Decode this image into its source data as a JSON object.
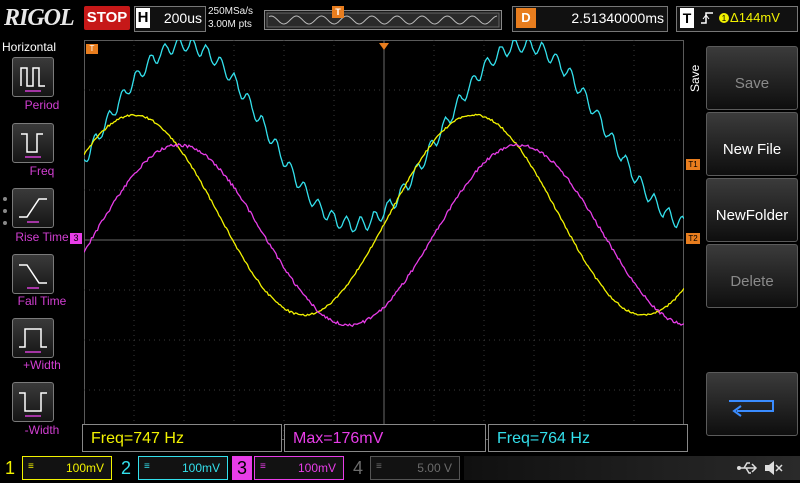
{
  "brand": "RIGOL",
  "run_state": "STOP",
  "timebase": {
    "label": "H",
    "value": "200us"
  },
  "acquisition": {
    "sample_rate": "250MSa/s",
    "memory_depth": "3.00M pts"
  },
  "trigger_position_marker": "T",
  "delay": {
    "label": "D",
    "value": "2.51340000ms"
  },
  "trigger": {
    "label": "T",
    "level": "144mV",
    "edge_icon": "rising-edge-icon",
    "source_color": "#f2f200"
  },
  "left_panel": {
    "title": "Horizontal",
    "items": [
      {
        "label": "Period",
        "icon": "period-icon"
      },
      {
        "label": "Freq",
        "icon": "freq-icon"
      },
      {
        "label": "Rise Time",
        "icon": "rise-time-icon"
      },
      {
        "label": "Fall Time",
        "icon": "fall-time-icon"
      },
      {
        "label": "+Width",
        "icon": "pos-width-icon"
      },
      {
        "label": "-Width",
        "icon": "neg-width-icon"
      }
    ]
  },
  "right_panel": {
    "tab": "Save",
    "buttons": [
      {
        "label": "Save",
        "enabled": false
      },
      {
        "label": "New File",
        "enabled": true
      },
      {
        "label": "NewFolder",
        "enabled": true
      },
      {
        "label": "Delete",
        "enabled": false
      },
      {
        "label": "",
        "icon": "enter-return-icon",
        "enabled": true
      }
    ]
  },
  "markers": {
    "t1": "T1",
    "t2": "T2",
    "ch3": "3",
    "trig_left": "T"
  },
  "measurements": [
    {
      "text": "Freq=747 Hz",
      "color": "#f2f200"
    },
    {
      "text": "Max=176mV",
      "color": "#e83de8"
    },
    {
      "text": "Freq=764 Hz",
      "color": "#33e0ec"
    }
  ],
  "channels": [
    {
      "num": "1",
      "coupling": "≡",
      "scale": "100mV",
      "color": "#f2f200",
      "active": true
    },
    {
      "num": "2",
      "coupling": "≡",
      "scale": "100mV",
      "color": "#33e0ec",
      "active": true
    },
    {
      "num": "3",
      "coupling": "≡",
      "scale": "100mV",
      "color": "#e83de8",
      "active": true
    },
    {
      "num": "4",
      "coupling": "≡",
      "scale": "5.00 V",
      "color": "#6b6b6b",
      "active": false
    }
  ],
  "status_icons": [
    "usb-icon",
    "speaker-muted-icon"
  ],
  "colors": {
    "ch1": "#f2f200",
    "ch2": "#33e0ec",
    "ch3": "#e83de8",
    "trigger": "#e87d1e",
    "stop": "#c61818"
  }
}
